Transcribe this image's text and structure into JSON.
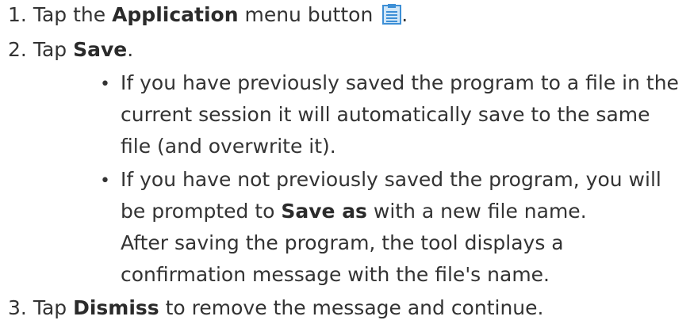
{
  "steps": [
    {
      "number": "1.",
      "pre": "Tap the ",
      "bold": "Application",
      "post": " menu button",
      "icon": "application-menu-icon",
      "trail": "."
    },
    {
      "number": "2.",
      "pre": "Tap ",
      "bold": "Save",
      "post": ".",
      "bullets": [
        {
          "lines": [
            "If you have previously saved the program to a file in the",
            "current session it will automatically save to the same",
            "file (and overwrite it)."
          ]
        },
        {
          "line1": "If you have not previously saved the program, you will",
          "line2_pre": "be prompted to ",
          "line2_bold": "Save as",
          "line2_post": " with a new file name.",
          "line3": "After saving the program, the tool displays a",
          "line4": "confirmation message with the file's name."
        }
      ]
    },
    {
      "number": "3.",
      "pre": "Tap ",
      "bold": "Dismiss",
      "post": " to remove the message and continue."
    }
  ],
  "bullet_glyph": "•",
  "colors": {
    "text": "#333333",
    "icon_blue": "#3d8fd6",
    "icon_light": "#cfe6f8"
  }
}
